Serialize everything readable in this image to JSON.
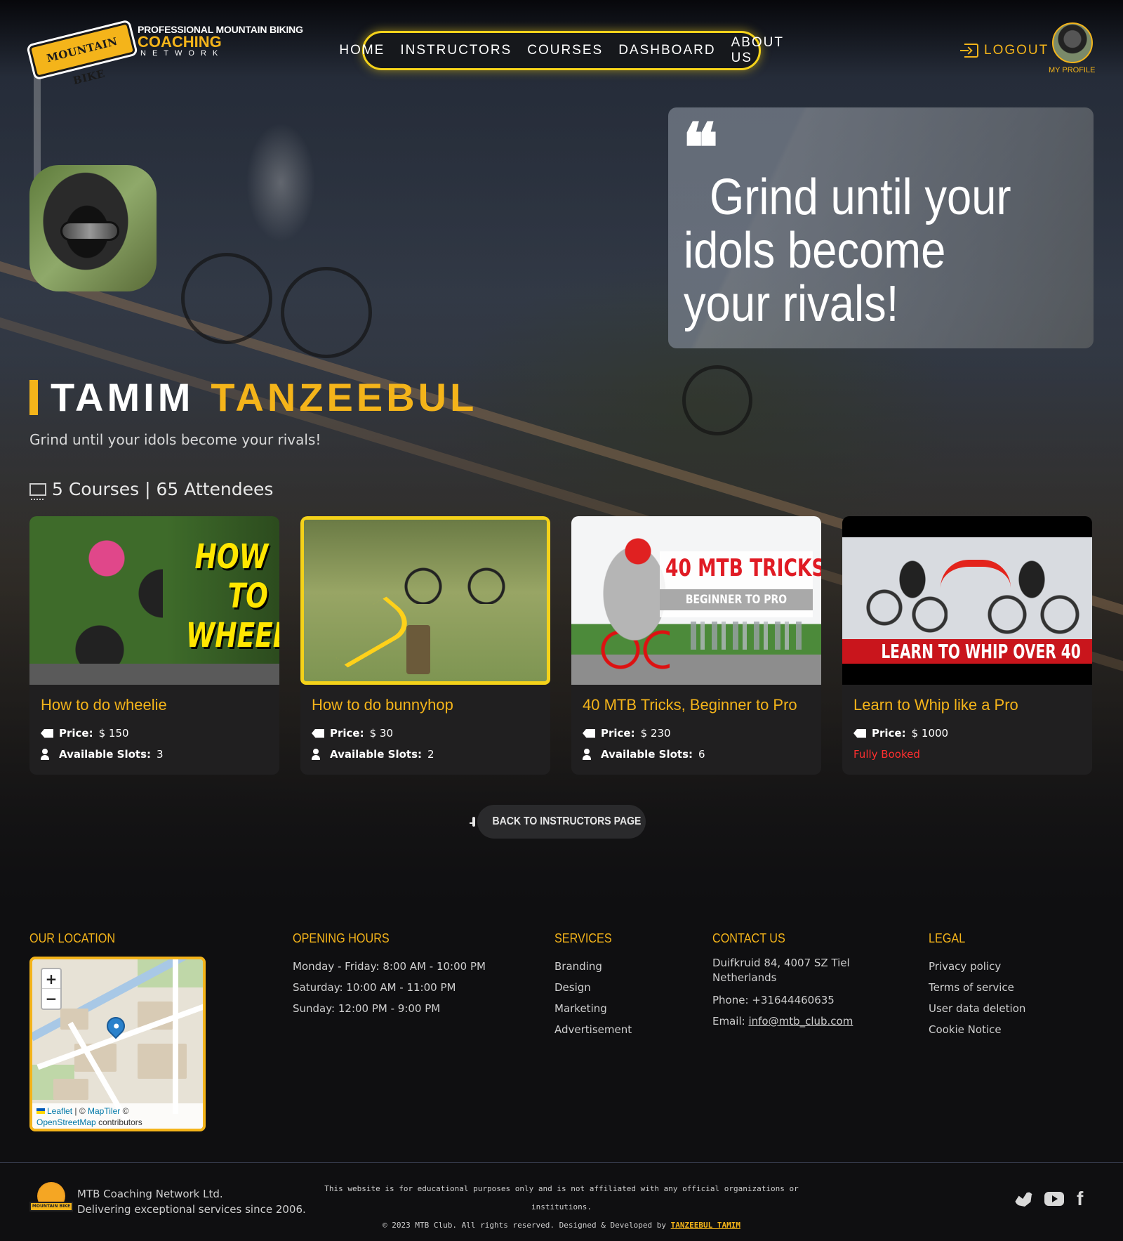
{
  "header": {
    "logo": {
      "badge_text": "MOUNTAIN BIKE",
      "line1": "PROFESSIONAL MOUNTAIN BIKING",
      "line2": "COACHING",
      "line3": "NETWORK"
    },
    "nav": [
      {
        "label": "HOME"
      },
      {
        "label": "INSTRUCTORS"
      },
      {
        "label": "COURSES"
      },
      {
        "label": "DASHBOARD"
      },
      {
        "label": "ABOUT US"
      }
    ],
    "logout_label": "LOGOUT",
    "profile_label": "MY PROFILE"
  },
  "instructor": {
    "quote": "Grind until your idols become your rivals!",
    "first_name": "TAMIM",
    "last_name": "TANZEEBUL",
    "tagline": "Grind until your idols become your rivals!",
    "stats": "5 Courses | 65 Attendees"
  },
  "courses": [
    {
      "title": "How to do wheelie",
      "price_label": "Price:",
      "price": "$ 150",
      "slots_label": "Available Slots:",
      "slots": "3",
      "image_text": "HOW TO WHEELIE!"
    },
    {
      "title": "How to do bunnyhop",
      "price_label": "Price:",
      "price": "$ 30",
      "slots_label": "Available Slots:",
      "slots": "2"
    },
    {
      "title": "40 MTB Tricks, Beginner to Pro",
      "price_label": "Price:",
      "price": "$ 230",
      "slots_label": "Available Slots:",
      "slots": "6",
      "image_text_1": "40 MTB TRICKS",
      "image_text_2": "BEGINNER TO PRO"
    },
    {
      "title": "Learn to Whip like a Pro",
      "price_label": "Price:",
      "price": "$ 1000",
      "status": "Fully Booked",
      "image_text": "LEARN TO WHIP OVER 40"
    }
  ],
  "back_button_label": "BACK TO INSTRUCTORS PAGE",
  "footer": {
    "location": {
      "heading": "OUR LOCATION",
      "map_zoom_in": "+",
      "map_zoom_out": "−",
      "map_attr_leaflet": "Leaflet",
      "map_attr_sep": "| ©",
      "map_attr_maptiler": "MapTiler",
      "map_attr_copy": "©",
      "map_attr_osm": "OpenStreetMap",
      "map_attr_contrib": "contributors"
    },
    "hours": {
      "heading": "OPENING HOURS",
      "items": [
        "Monday - Friday: 8:00 AM - 10:00 PM",
        "Saturday: 10:00 AM - 11:00 PM",
        "Sunday: 12:00 PM - 9:00 PM"
      ]
    },
    "services": {
      "heading": "SERVICES",
      "items": [
        "Branding",
        "Design",
        "Marketing",
        "Advertisement"
      ]
    },
    "contact": {
      "heading": "CONTACT US",
      "address_line1": "Duifkruid 84, 4007 SZ Tiel",
      "address_line2": "Netherlands",
      "phone": "Phone: +31644460635",
      "email_label": "Email:",
      "email": "info@mtb_club.com"
    },
    "legal": {
      "heading": "LEGAL",
      "items": [
        "Privacy policy",
        "Terms of service",
        "User data deletion",
        "Cookie Notice"
      ]
    },
    "company_name": "MTB Coaching Network Ltd.",
    "company_tagline": "Delivering exceptional services since 2006.",
    "disclaimer": "This website is for educational purposes only and is not affiliated with any official organizations or institutions.",
    "copyright": "© 2023 MTB Club. All rights reserved. Designed & Developed by",
    "developer": "TANZEEBUL TAMIM",
    "social": [
      "twitter-icon",
      "youtube-icon",
      "facebook-icon"
    ]
  },
  "colors": {
    "accent": "#f4b41a",
    "nav_border": "#f4d21a",
    "booked": "#ff2f2f",
    "background": "#0f0f11"
  }
}
